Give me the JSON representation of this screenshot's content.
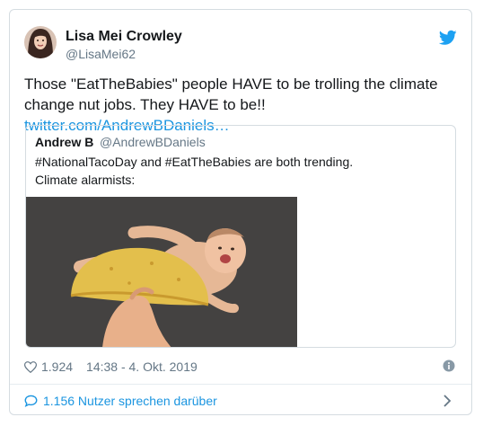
{
  "tweet": {
    "author_name": "Lisa Mei Crowley",
    "author_handle": "@LisaMei62",
    "text_before_link": "Those \"EatTheBabies\" people HAVE to be trolling the climate change nut jobs. They HAVE to be!! ",
    "link_text": "twitter.com/AndrewBDaniels…"
  },
  "quoted_tweet": {
    "author_name": "Andrew B",
    "author_handle": "@AndrewBDaniels",
    "line1": "#NationalTacoDay and #EatTheBabies are both trending.",
    "line2": "Climate alarmists:"
  },
  "meta": {
    "likes": "1.924",
    "timestamp": "14:38 - 4. Okt. 2019"
  },
  "footer": {
    "talking_text": "1.156 Nutzer sprechen darüber"
  },
  "colors": {
    "brand_blue": "#1da1f2",
    "link_blue": "#1b95e0",
    "secondary_text": "#657786"
  },
  "icons": [
    "twitter-bird-icon",
    "heart-icon",
    "info-icon",
    "speech-bubble-icon",
    "chevron-right-icon"
  ]
}
